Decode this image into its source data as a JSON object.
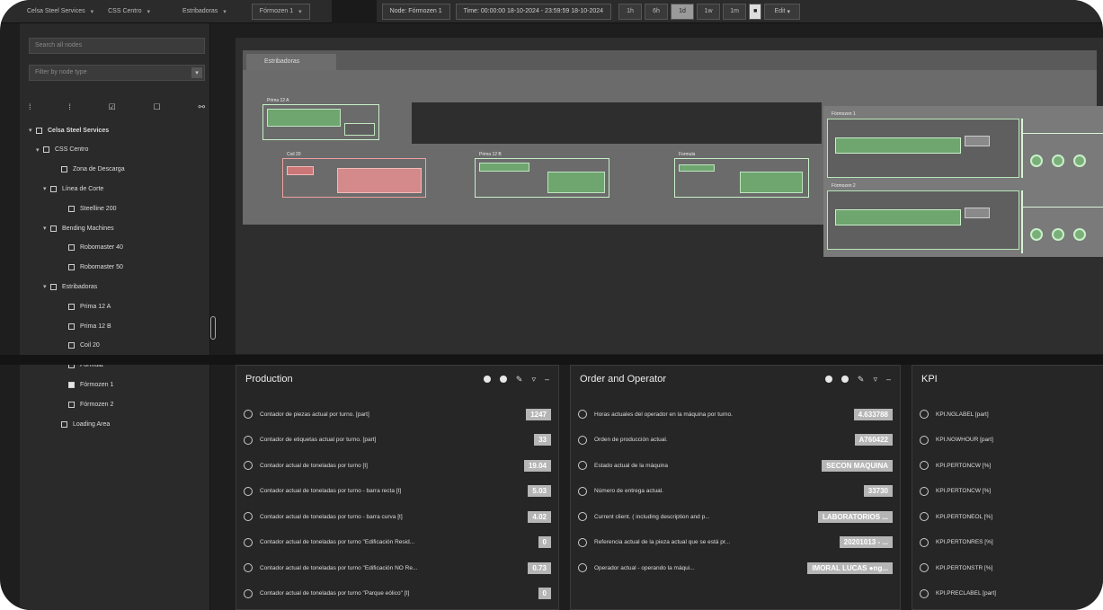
{
  "topbar": {
    "crumbs": [
      "Celsa Steel Services",
      "CSS Centro",
      "Estribadoras",
      "Fórmozen 1"
    ],
    "node_field": "Node: Fórmozen 1",
    "time_field": "Time: 00:00:00 18-10-2024 - 23:59:59 18-10-2024",
    "range_buttons": [
      "1h",
      "6h",
      "1d",
      "1w",
      "1m"
    ],
    "mode_label": "Edit"
  },
  "sidebar": {
    "search_placeholder": "Search all nodes",
    "filter_placeholder": "Filter by node type",
    "tree": [
      {
        "label": "Celsa Steel Services",
        "level": 0,
        "toggle": "▾",
        "checked": false
      },
      {
        "label": "CSS Centro",
        "level": 1,
        "toggle": "▾",
        "checked": false
      },
      {
        "label": "Zona de Descarga",
        "level": 2,
        "toggle": "",
        "checked": false
      },
      {
        "label": "Línea de Corte",
        "level": 1,
        "toggle": "▾",
        "checked": false,
        "indent": 2
      },
      {
        "label": "Steelline 200",
        "level": 3,
        "toggle": "",
        "checked": false
      },
      {
        "label": "Bending Machines",
        "level": 1,
        "toggle": "▾",
        "checked": false,
        "indent": 2
      },
      {
        "label": "Robomaster 40",
        "level": 3,
        "toggle": "",
        "checked": false
      },
      {
        "label": "Robomaster 50",
        "level": 3,
        "toggle": "",
        "checked": false
      },
      {
        "label": "Estribadoras",
        "level": 1,
        "toggle": "▾",
        "checked": false,
        "indent": 2
      },
      {
        "label": "Prima 12 A",
        "level": 3,
        "toggle": "",
        "checked": false
      },
      {
        "label": "Prima 12 B",
        "level": 3,
        "toggle": "",
        "checked": false
      },
      {
        "label": "Coil 20",
        "level": 3,
        "toggle": "",
        "checked": false
      },
      {
        "label": "Formula",
        "level": 3,
        "toggle": "",
        "checked": false
      },
      {
        "label": "Fórmozen 1",
        "level": 3,
        "toggle": "",
        "checked": true
      },
      {
        "label": "Fórmozen 2",
        "level": 3,
        "toggle": "",
        "checked": false
      },
      {
        "label": "Loading Area",
        "level": 2,
        "toggle": "",
        "checked": false
      }
    ]
  },
  "canvas": {
    "tab_label": "Estribadoras",
    "machines": [
      "Prima 12 A",
      "Coil 20",
      "Prima 12 B",
      "Formula",
      "Fórmozen 1",
      "Fórmozen 2"
    ]
  },
  "production": {
    "title": "Production",
    "rows": [
      {
        "label": "Contador de piezas actual por turno. [part]",
        "value": "1247"
      },
      {
        "label": "Contador de etiquetas actual por turno. [part]",
        "value": "33"
      },
      {
        "label": "Contador actual de toneladas por turno [t]",
        "value": "19.04"
      },
      {
        "label": "Contador actual de toneladas por turno - barra recta [t]",
        "value": "5.03"
      },
      {
        "label": "Contador actual de toneladas por turno - barra curva [t]",
        "value": "4.02"
      },
      {
        "label": "Contador actual de toneladas por turno \"Edificación Resid...",
        "value": "0"
      },
      {
        "label": "Contador actual de toneladas por turno \"Edificación NO Re...",
        "value": "0.73"
      },
      {
        "label": "Contador actual de toneladas por turno \"Parque eólico\" [t]",
        "value": "0"
      }
    ]
  },
  "order": {
    "title": "Order and Operator",
    "rows": [
      {
        "label": "Horas actuales del operador en la máquina por turno.",
        "value": "4.633788"
      },
      {
        "label": "Orden de producción actual.",
        "value": "A760422"
      },
      {
        "label": "Estado actual de la máquina",
        "value": "SECON MAQUINA"
      },
      {
        "label": "Número de entrega actual.",
        "value": "33730"
      },
      {
        "label": "Current client. ( including description and p...",
        "value": "LABORATORIOS ..."
      },
      {
        "label": "Referencia actual de la pieza actual que se está pr...",
        "value": "20201013 - ..."
      },
      {
        "label": "Operador actual - operando la máqui...",
        "value": "IMORAL LUCAS ●ng..."
      }
    ]
  },
  "kpi": {
    "title": "KPI",
    "rows": [
      {
        "label": "KPI.NGLABEL [part]"
      },
      {
        "label": "KPI.NGWHOUR [part]"
      },
      {
        "label": "KPI.PERTONCW [%]"
      },
      {
        "label": "KPI.PERTONCW [%]"
      },
      {
        "label": "KPI.PERTONEOL [%]"
      },
      {
        "label": "KPI.PERTONRES [%]"
      },
      {
        "label": "KPI.PERTONSTR [%]"
      },
      {
        "label": "KPI.PRECLABEL [part]"
      }
    ]
  }
}
